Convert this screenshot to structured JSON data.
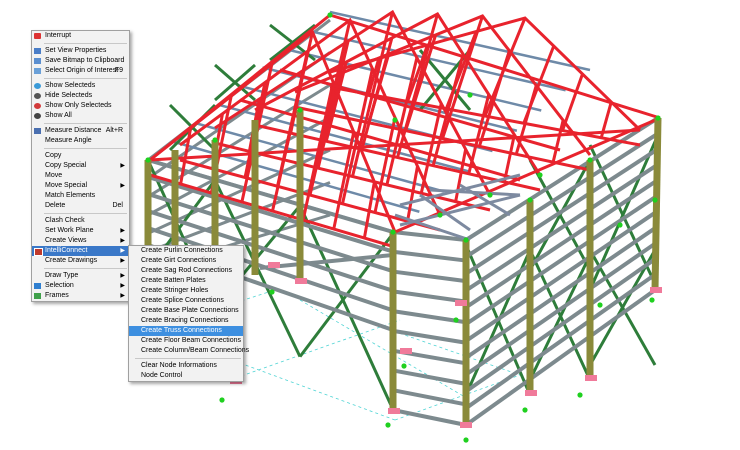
{
  "context_menu": {
    "items": [
      {
        "label": "Interrupt",
        "icon": "interrupt-icon"
      },
      {
        "sep": true
      },
      {
        "label": "Set View Properties",
        "icon": "view-properties-icon"
      },
      {
        "label": "Save Bitmap to Clipboard",
        "icon": "clipboard-icon"
      },
      {
        "label": "Select Origin of Interest",
        "shortcut": "F9",
        "icon": "origin-icon"
      },
      {
        "sep": true
      },
      {
        "label": "Show Selecteds",
        "icon": "show-selected-icon"
      },
      {
        "label": "Hide Selecteds",
        "icon": "hide-selected-icon"
      },
      {
        "label": "Show Only Selecteds",
        "icon": "show-only-icon"
      },
      {
        "label": "Show All",
        "icon": "show-all-icon"
      },
      {
        "sep": true
      },
      {
        "label": "Measure Distance",
        "shortcut": "Alt+R",
        "icon": "ruler-icon"
      },
      {
        "label": "Measure Angle"
      },
      {
        "sep": true
      },
      {
        "label": "Copy"
      },
      {
        "label": "Copy Special",
        "submenu": true
      },
      {
        "label": "Move"
      },
      {
        "label": "Move Special",
        "submenu": true
      },
      {
        "label": "Match Elements"
      },
      {
        "label": "Delete",
        "shortcut": "Del"
      },
      {
        "sep": true
      },
      {
        "label": "Clash Check"
      },
      {
        "label": "Set Work Plane",
        "submenu": true
      },
      {
        "label": "Create Views",
        "submenu": true
      },
      {
        "label": "IntelliConnect",
        "submenu": true,
        "highlighted": true,
        "icon": "intelliconnect-icon"
      },
      {
        "label": "Create Drawings",
        "submenu": true
      },
      {
        "sep": true
      },
      {
        "label": "Draw Type",
        "submenu": true
      },
      {
        "label": "Selection",
        "submenu": true,
        "icon": "selection-icon"
      },
      {
        "label": "Frames",
        "submenu": true,
        "icon": "frames-icon"
      }
    ]
  },
  "submenu": {
    "items": [
      {
        "label": "Create Purlin Connections"
      },
      {
        "label": "Create Girt Connections"
      },
      {
        "label": "Create Sag Rod Connections"
      },
      {
        "label": "Create Batten Plates"
      },
      {
        "label": "Create Stringer Holes"
      },
      {
        "label": "Create Splice Connections"
      },
      {
        "label": "Create Base Plate Connections"
      },
      {
        "label": "Create Bracing Connections"
      },
      {
        "label": "Create Truss Connections",
        "highlighted": true
      },
      {
        "label": "Create Floor Beam Connections"
      },
      {
        "label": "Create Column/Beam Connections"
      },
      {
        "sep": true
      },
      {
        "label": "Clear Node Informations"
      },
      {
        "label": "Node Control"
      }
    ]
  },
  "colors": {
    "truss_red": "#e8232d",
    "brace_green": "#2e7d3a",
    "column_olive": "#8a8a3a",
    "girt_gray": "#7d8a8e",
    "purlin_steel": "#6e8aa8",
    "node_green": "#1fd01f",
    "base_pink": "#f07a9a",
    "menu_highlight": "#3a78c8",
    "grid_cyan": "#4fd4d4"
  }
}
